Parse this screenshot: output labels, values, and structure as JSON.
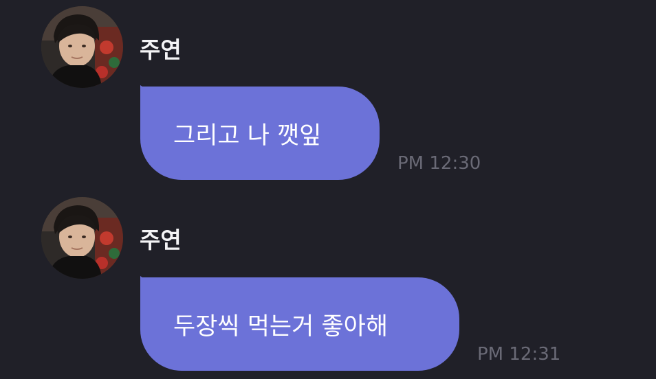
{
  "messages": [
    {
      "sender": "주연",
      "text": "그리고 나 깻잎",
      "time": "PM 12:30"
    },
    {
      "sender": "주연",
      "text": "두장씩 먹는거 좋아해",
      "time": "PM 12:31"
    }
  ],
  "colors": {
    "background": "#202028",
    "bubble": "#6c72d8",
    "name_text": "#f4f4f6",
    "timestamp_text": "#6a6a76"
  },
  "icons": {
    "avatar": "profile-photo"
  }
}
